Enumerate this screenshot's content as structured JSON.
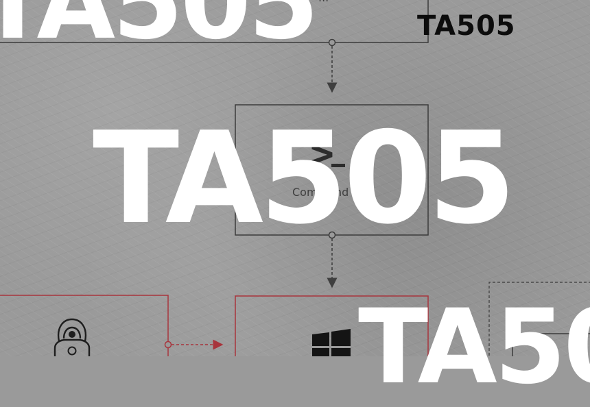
{
  "logo": {
    "text": "TA505"
  },
  "watermarks": {
    "text": "TA505"
  },
  "diagram": {
    "top_node_label_fragment": "...",
    "command_line": {
      "label": "Command line",
      "icon": "terminal-prompt-icon"
    },
    "actor_node": {
      "icon": "hooded-hacker-biohazard-icon"
    },
    "windows_node": {
      "icon": "windows-logo-icon"
    }
  },
  "colors": {
    "background": "#9a9a9a",
    "box_stroke": "#3b3b3b",
    "actor_stroke": "#a8343c",
    "watermark": "#ffffff",
    "logo": "#0c0c0c"
  }
}
